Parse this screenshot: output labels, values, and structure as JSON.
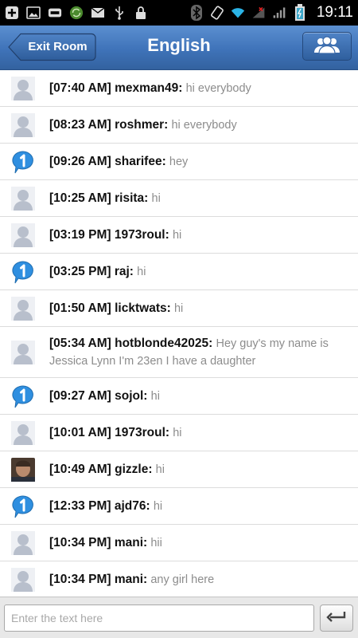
{
  "status_bar": {
    "time": "19:11",
    "left_icons": [
      "add-icon",
      "image-icon",
      "keyboard-icon",
      "sync-icon",
      "mail-icon",
      "usb-icon",
      "lock-icon"
    ],
    "right_icons": [
      "bluetooth-icon",
      "rotate-icon",
      "wifi-icon",
      "signal-off-icon",
      "signal-icon",
      "battery-icon"
    ]
  },
  "header": {
    "title": "English",
    "exit_label": "Exit Room",
    "users_icon": "users-icon",
    "color": "#3f73b9"
  },
  "messages": [
    {
      "time": "[07:40 AM]",
      "user": "mexman49:",
      "text": "hi everybody",
      "avatar": "default"
    },
    {
      "time": "[08:23 AM]",
      "user": "roshmer:",
      "text": "hi everybody",
      "avatar": "default"
    },
    {
      "time": "[09:26 AM]",
      "user": "sharifee:",
      "text": "hey",
      "avatar": "badge"
    },
    {
      "time": "[10:25 AM]",
      "user": "risita:",
      "text": "hi",
      "avatar": "default"
    },
    {
      "time": "[03:19 PM]",
      "user": "1973roul:",
      "text": "hi",
      "avatar": "default"
    },
    {
      "time": "[03:25 PM]",
      "user": "raj:",
      "text": "hi",
      "avatar": "badge"
    },
    {
      "time": "[01:50 AM]",
      "user": "licktwats:",
      "text": "hi",
      "avatar": "default"
    },
    {
      "time": "[05:34 AM]",
      "user": "hotblonde42025:",
      "text": "Hey guy's my name is Jessica Lynn I'm 23en I have a daughter",
      "avatar": "default"
    },
    {
      "time": "[09:27 AM]",
      "user": "sojol:",
      "text": "hi",
      "avatar": "badge"
    },
    {
      "time": "[10:01 AM]",
      "user": "1973roul:",
      "text": "hi",
      "avatar": "default"
    },
    {
      "time": "[10:49 AM]",
      "user": "gizzle:",
      "text": "hi",
      "avatar": "photo"
    },
    {
      "time": "[12:33 PM]",
      "user": "ajd76:",
      "text": "hi",
      "avatar": "badge"
    },
    {
      "time": "[10:34 PM]",
      "user": "mani:",
      "text": "hii",
      "avatar": "default"
    },
    {
      "time": "[10:34 PM]",
      "user": "mani:",
      "text": "any girl here",
      "avatar": "default"
    }
  ],
  "composer": {
    "placeholder": "Enter the text here",
    "value": "",
    "send_icon": "enter-icon"
  }
}
